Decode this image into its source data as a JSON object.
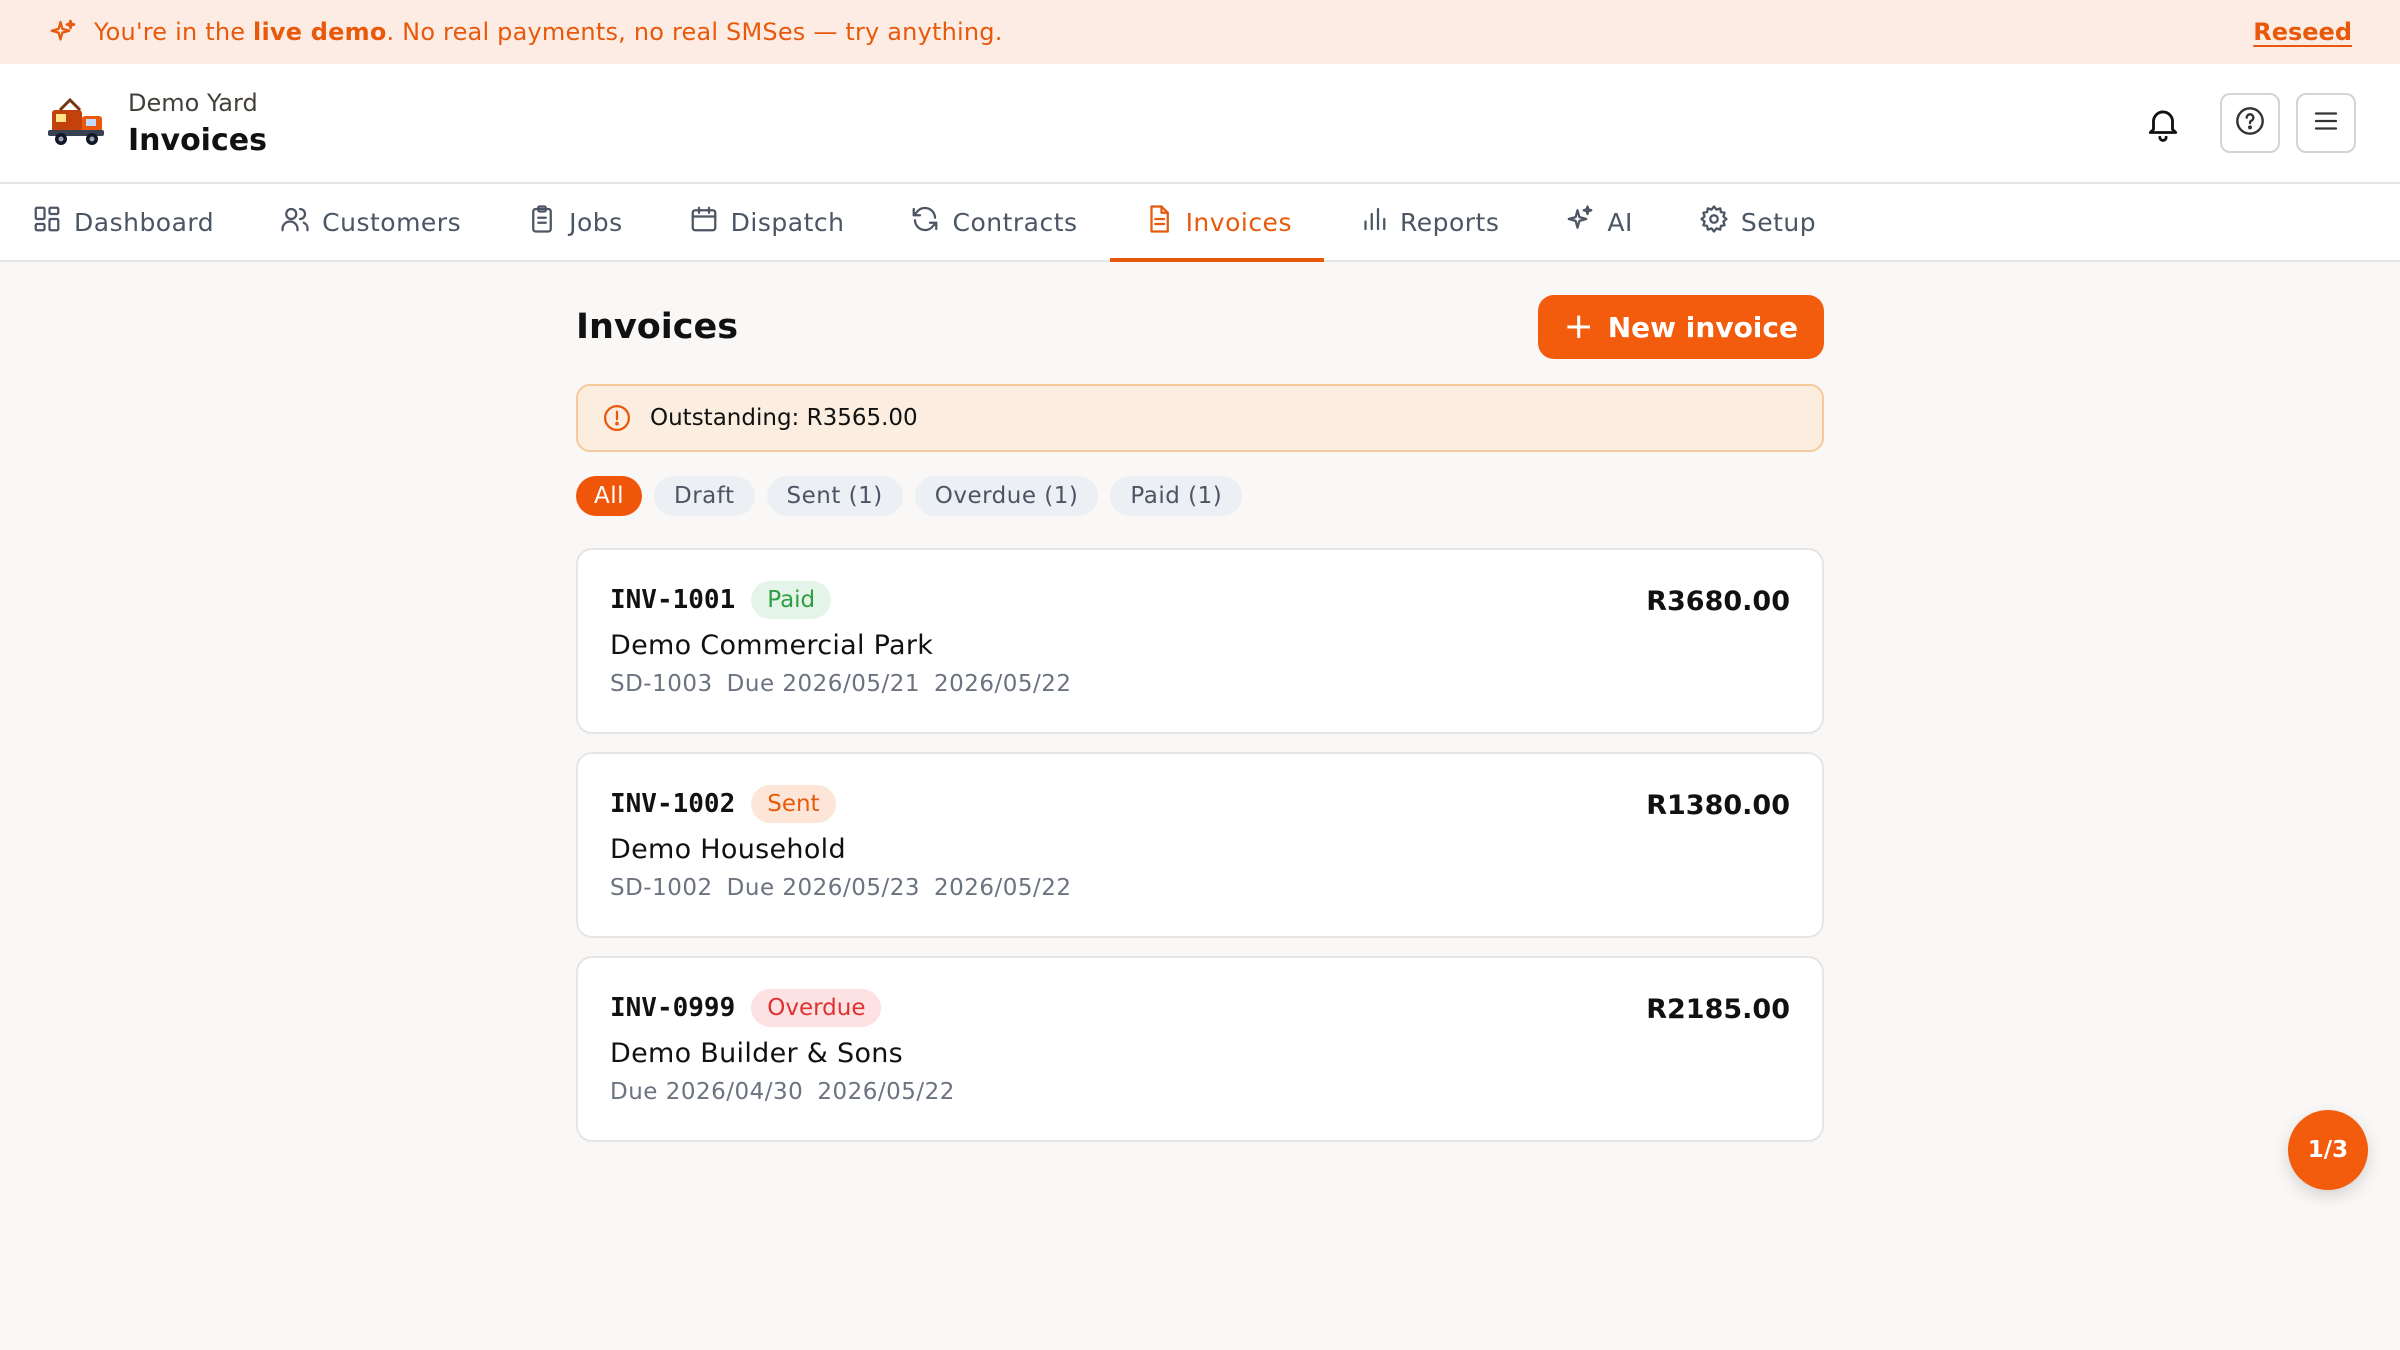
{
  "banner": {
    "prefix": "You're in the ",
    "bold": "live demo",
    "suffix": ". No real payments, no real SMSes — try anything.",
    "reseed_label": "Reseed"
  },
  "header": {
    "yard_name": "Demo Yard",
    "page_name": "Invoices"
  },
  "nav": {
    "tabs": [
      {
        "label": "Dashboard",
        "icon": "dashboard-icon"
      },
      {
        "label": "Customers",
        "icon": "users-icon"
      },
      {
        "label": "Jobs",
        "icon": "clipboard-icon"
      },
      {
        "label": "Dispatch",
        "icon": "calendar-icon"
      },
      {
        "label": "Contracts",
        "icon": "refresh-icon"
      },
      {
        "label": "Invoices",
        "icon": "document-icon"
      },
      {
        "label": "Reports",
        "icon": "bar-chart-icon"
      },
      {
        "label": "AI",
        "icon": "sparkles-icon"
      },
      {
        "label": "Setup",
        "icon": "gear-icon"
      }
    ],
    "active": "Invoices"
  },
  "main": {
    "title": "Invoices",
    "new_button_label": "New invoice",
    "outstanding_text": "Outstanding: R3565.00",
    "filters": [
      "All",
      "Draft",
      "Sent (1)",
      "Overdue (1)",
      "Paid (1)"
    ],
    "active_filter": "All",
    "invoices": [
      {
        "number": "INV-1001",
        "status": "Paid",
        "customer": "Demo Commercial Park",
        "job": "SD-1003",
        "due": "Due 2026/05/21",
        "date": "2026/05/22",
        "amount": "R3680.00"
      },
      {
        "number": "INV-1002",
        "status": "Sent",
        "customer": "Demo Household",
        "job": "SD-1002",
        "due": "Due 2026/05/23",
        "date": "2026/05/22",
        "amount": "R1380.00"
      },
      {
        "number": "INV-0999",
        "status": "Overdue",
        "customer": "Demo Builder & Sons",
        "job": "",
        "due": "Due 2026/04/30",
        "date": "2026/05/22",
        "amount": "R2185.00"
      }
    ]
  },
  "counter": "1/3",
  "colors": {
    "accent": "#f25c0c",
    "banner_bg": "#fdece3",
    "paid": "#2f9e44",
    "sent": "#e8590c",
    "overdue": "#e03131"
  }
}
